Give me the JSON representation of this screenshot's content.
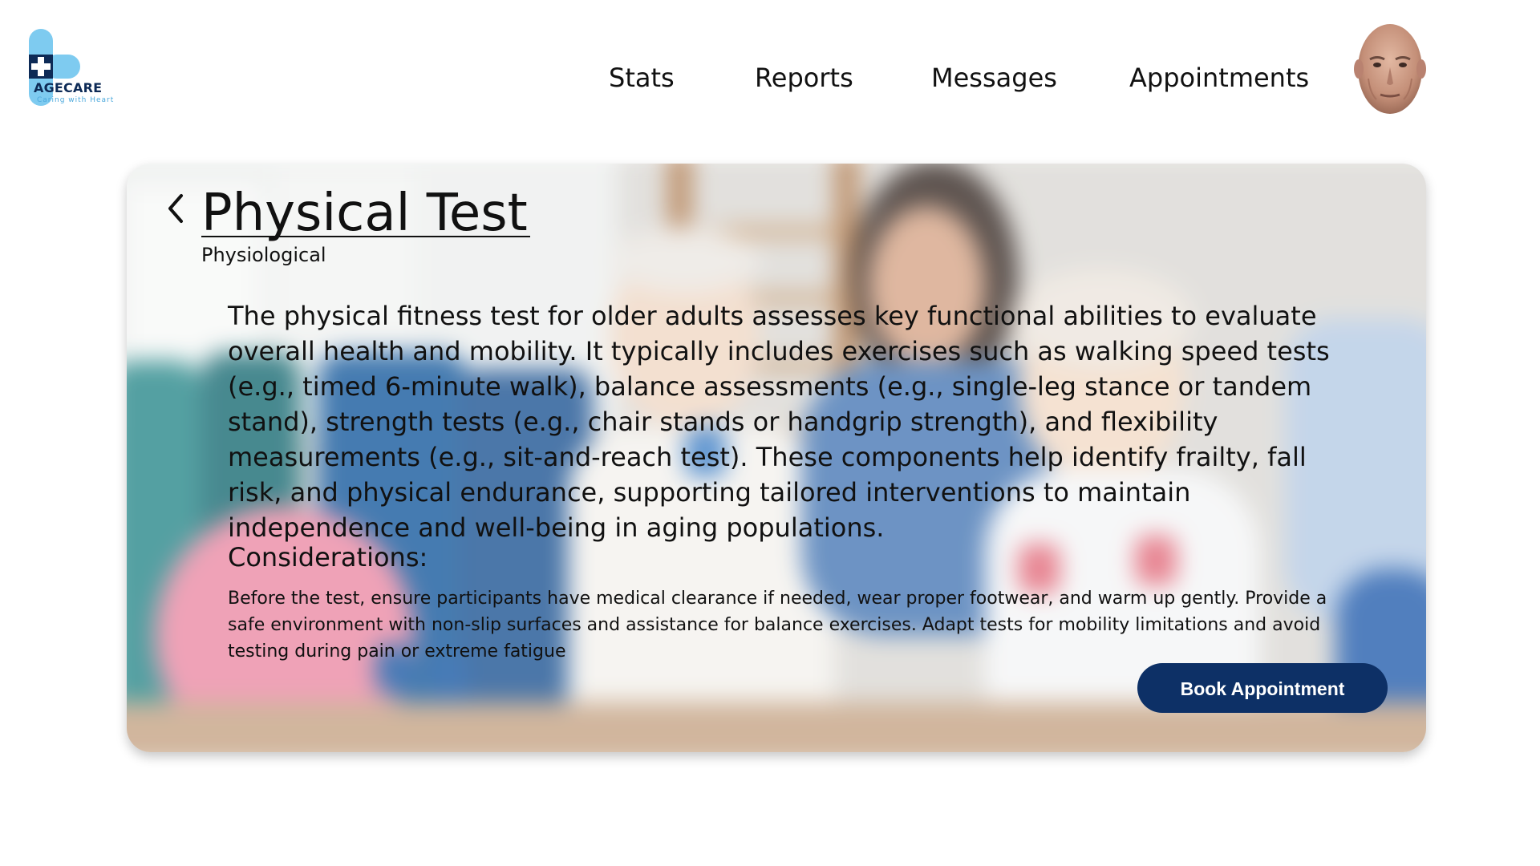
{
  "brand": {
    "name": "AGECARE",
    "tagline": "Caring with Heart",
    "colors": {
      "navy": "#0d2a56",
      "light_blue": "#4aa8dc",
      "button": "#0d3066"
    }
  },
  "nav": {
    "items": [
      {
        "label": "Stats"
      },
      {
        "label": "Reports"
      },
      {
        "label": "Messages"
      },
      {
        "label": "Appointments"
      }
    ]
  },
  "user": {
    "avatar_icon": "elderly-man-avatar"
  },
  "card": {
    "title": "Physical Test",
    "subtitle": "Physiological",
    "back_icon": "chevron-left-icon",
    "description": "The physical fitness test for older adults assesses key functional abilities to evaluate overall health and mobility. It typically includes exercises such as walking speed tests (e.g., timed 6-minute walk), balance assessments (e.g., single-leg stance or tandem stand), strength tests (e.g., chair stands or handgrip strength), and flexibility measurements (e.g., sit-and-reach test). These components help identify frailty, fall risk, and physical endurance, supporting tailored interventions to maintain independence and well-being in aging populations.",
    "considerations_heading": "Considerations:",
    "considerations_text": "Before the test, ensure participants have medical clearance if needed, wear proper footwear, and warm up gently. Provide a safe environment with non-slip surfaces and assistance for balance exercises. Adapt tests for mobility limitations and avoid testing during pain or extreme fatigue",
    "cta_label": "Book Appointment",
    "background_image": "blurred-seniors-exercising-with-dumbbells-photo"
  }
}
